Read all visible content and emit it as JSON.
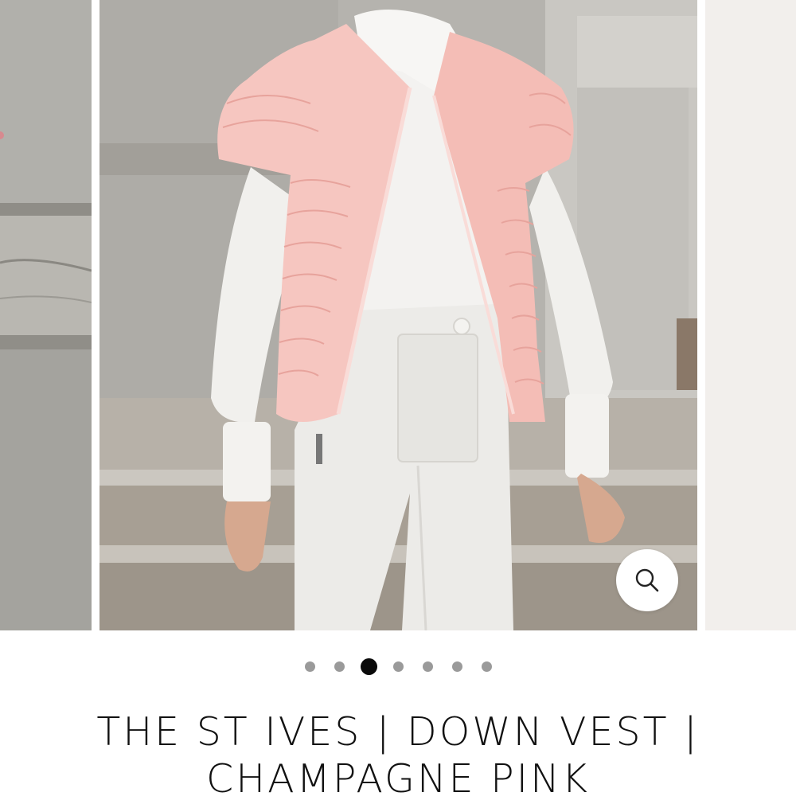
{
  "gallery": {
    "zoom_icon": "magnifier-icon",
    "dot_count": 7,
    "active_dot": 3
  },
  "product": {
    "title_line1": "THE ST IVES | DOWN VEST |",
    "title_line2": "CHAMPAGNE PINK"
  },
  "colors": {
    "vest": "#f6c6c0",
    "garment": "#efedea",
    "background_stone": "#b8b6b1",
    "active_dot": "#0a0a0a",
    "inactive_dot": "#9a9a9a"
  }
}
